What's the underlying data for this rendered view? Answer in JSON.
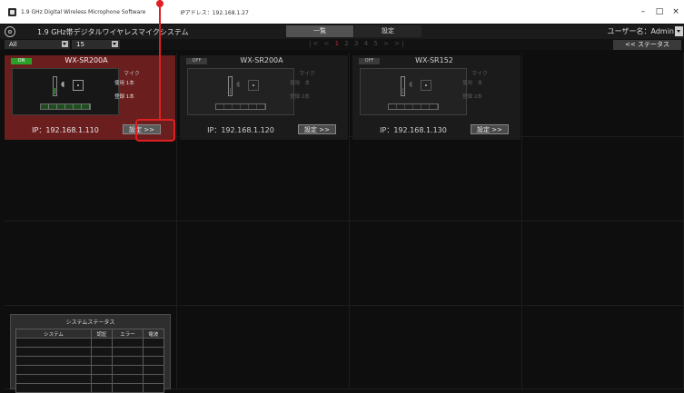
{
  "window": {
    "title": "1.9 GHz Digital Wireless Microphone Software",
    "ip_address": "IPアドレス：192.168.1.27",
    "buttons": [
      "–",
      "□",
      "×"
    ]
  },
  "header": {
    "app_title": "1.9 GHz帯デジタルワイヤレスマイクシステム",
    "tabs": [
      "一覧",
      "設定"
    ],
    "user_label": "ユーザー名：Admin"
  },
  "filter": {
    "group_value": "All",
    "count_value": "15",
    "pager": {
      "first": "|<",
      "prev": "<",
      "pages": [
        "1",
        "2",
        "3",
        "4",
        "5"
      ],
      "next": ">",
      "last": ">|"
    },
    "status_button": "<< ステータス"
  },
  "cards": [
    {
      "state": "ON",
      "model": "WX-SR200A",
      "mic": "マイク",
      "use": "使用 1本",
      "reg": "登録 1本",
      "ip": "IP：192.168.1.110",
      "button": "設定 >>"
    },
    {
      "state": "OFF",
      "model": "WX-SR200A",
      "mic": "マイク",
      "use": "使用　本",
      "reg": "登録 2本",
      "ip": "IP：192.168.1.120",
      "button": "設定 >>"
    },
    {
      "state": "OFF",
      "model": "WX-SR152",
      "mic": "マイク",
      "use": "使用　本",
      "reg": "登録 2本",
      "ip": "IP：192.168.1.130",
      "button": "設定 >>"
    }
  ],
  "system_status": {
    "title": "システムステータス",
    "columns": [
      "システム",
      "認証",
      "エラー",
      "電波"
    ]
  },
  "colors": {
    "accent_red": "#e02020",
    "active_card": "#6b1e1e",
    "on_green": "#2aa02a"
  }
}
